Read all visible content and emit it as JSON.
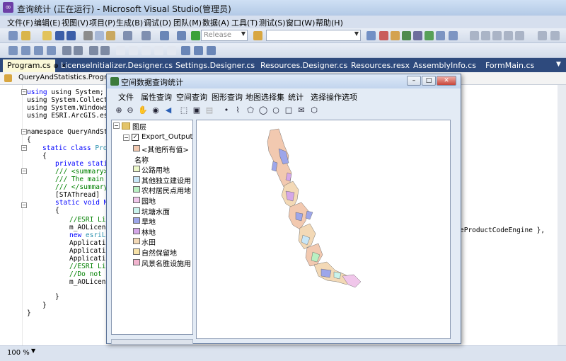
{
  "window": {
    "title": "查询统计 (正在运行) - Microsoft Visual Studio(管理员)"
  },
  "menu": [
    "文件(F)",
    "编辑(E)",
    "视图(V)",
    "项目(P)",
    "生成(B)",
    "调试(D)",
    "团队(M)",
    "数据(A)",
    "工具(T)",
    "测试(S)",
    "窗口(W)",
    "帮助(H)"
  ],
  "toolbar": {
    "config_value": "Release",
    "platform_value": ""
  },
  "tabs": [
    "Program.cs",
    "LicenseInitializer.Designer.cs",
    "Settings.Designer.cs",
    "Resources.Designer.cs",
    "Resources.resx",
    "AssemblyInfo.cs",
    "FormMain.cs"
  ],
  "navbar": {
    "class_combo": "QueryAndStatistics.Program"
  },
  "code": {
    "l1": "using System;",
    "l2": "using System.Collectio",
    "l3": "using System.Windows.F",
    "l4": "using ESRI.ArcGIS.esri",
    "l5": "namespace QueryAndStat",
    "l6": "{",
    "l7a": "static class ",
    "l7b": "Progr",
    "l8": "{",
    "l9a": "private ",
    "l9b": "static",
    "l10": "/// <summary>",
    "l11": "/// The main e",
    "l12": "/// </summary>",
    "l13": "[STAThread]",
    "l14a": "static ",
    "l14b": "void Ma",
    "l15": "{",
    "l16": "//ESRI Lic",
    "l17": "m_AOLicens",
    "l17r": "eProductCodeEngine },",
    "l18a": "new ",
    "l18b": "esriLi",
    "l19": "Applicatio",
    "l20": "Applicatio",
    "l21": "Applicatio",
    "l22": "//ESRI Lic",
    "l23": "//Do not m",
    "l24": "m_AOLicens",
    "l25": "}",
    "l26": "}",
    "l27": "}"
  },
  "status": {
    "zoom": "100 %"
  },
  "dialog": {
    "title": "空间数据查询统计",
    "menu": [
      "文件",
      "属性查询",
      "空间查询",
      "图形查询",
      "地图选择集",
      "统计",
      "选择操作选项"
    ],
    "toc": {
      "root": "图层",
      "layer": "Export_Output",
      "items": [
        {
          "label": "<其他所有值>",
          "color": "#f2c9b0"
        },
        {
          "label": "名称",
          "color": ""
        },
        {
          "label": "公路用地",
          "color": "#ecf8c8"
        },
        {
          "label": "其他独立建设用",
          "color": "#c7e6f7"
        },
        {
          "label": "农村居民点用地",
          "color": "#b9f0c2"
        },
        {
          "label": "园地",
          "color": "#f0c6ea"
        },
        {
          "label": "坑塘水面",
          "color": "#c9f3ec"
        },
        {
          "label": "旱地",
          "color": "#9da6ea"
        },
        {
          "label": "林地",
          "color": "#d5a7e8"
        },
        {
          "label": "水田",
          "color": "#f3d9b6"
        },
        {
          "label": "自然保留地",
          "color": "#f7e2a7"
        },
        {
          "label": "风景名胜设施用",
          "color": "#f2b4cf"
        }
      ]
    }
  }
}
